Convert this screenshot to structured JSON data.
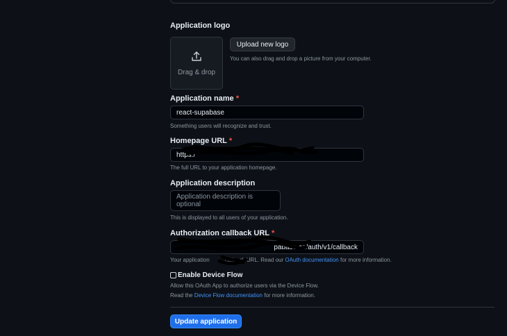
{
  "logo": {
    "label": "Application logo",
    "dropzone_text": "Drag & drop",
    "upload_button": "Upload new logo",
    "hint": "You can also drag and drop a picture from your computer."
  },
  "app_name": {
    "label": "Application name",
    "required_mark": "*",
    "value": "react-supabase",
    "hint": "Something users will recognize and trust."
  },
  "homepage": {
    "label": "Homepage URL",
    "required_mark": "*",
    "value_visible": "https:/",
    "hint": "The full URL to your application homepage."
  },
  "description": {
    "label": "Application description",
    "placeholder": "Application description is optional",
    "hint": "This is displayed to all users of your application."
  },
  "callback": {
    "label": "Authorization callback URL",
    "required_mark": "*",
    "value_visible": "pabase.co/auth/v1/callback",
    "hint_prefix": "Your application",
    "hint_mid": "callback URL. Read our",
    "hint_link": "OAuth documentation",
    "hint_suffix": "for more information."
  },
  "device_flow": {
    "label": "Enable Device Flow",
    "checked": false,
    "desc": "Allow this OAuth App to authorize users via the Device Flow.",
    "read_prefix": "Read the",
    "read_link": "Device Flow documentation",
    "read_suffix": "for more information."
  },
  "submit": {
    "label": "Update application"
  },
  "colors": {
    "background": "#0d1117",
    "primary_button": "#1f6feb",
    "link": "#4493f8",
    "required": "#f85149"
  },
  "icons": {
    "upload": "upload-icon"
  }
}
